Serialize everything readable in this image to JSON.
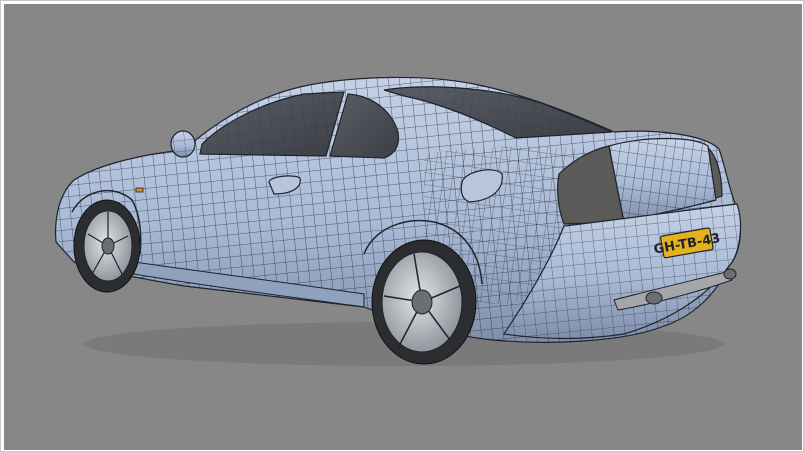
{
  "viewport": {
    "background_color": "#878787",
    "model_color": "#a9bad6",
    "wire_color": "#1e232d",
    "glass_color": "#4a4e55",
    "taillight_color": "#5c5a58",
    "wheel_color": "#b9bcc1",
    "tire_color": "#2b2d30"
  },
  "model": {
    "license_plate_text": "GH-TB-43",
    "plate_color": "#e3b21c"
  }
}
